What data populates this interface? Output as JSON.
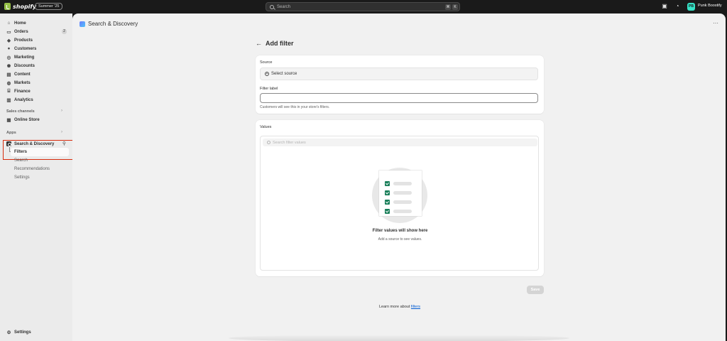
{
  "topbar": {
    "brand": "shopify",
    "edition_badge": "Summer '25",
    "search_placeholder": "Search",
    "shortcut_keys": [
      "⌘",
      "K"
    ],
    "store_initials": "PB",
    "store_name": "Punk Boostify"
  },
  "sidebar": {
    "items": [
      {
        "label": "Home",
        "icon": "home-icon"
      },
      {
        "label": "Orders",
        "icon": "orders-icon",
        "count": "2"
      },
      {
        "label": "Products",
        "icon": "tag-icon"
      },
      {
        "label": "Customers",
        "icon": "person-icon"
      },
      {
        "label": "Marketing",
        "icon": "target-icon"
      },
      {
        "label": "Discounts",
        "icon": "discount-icon"
      },
      {
        "label": "Content",
        "icon": "content-icon"
      },
      {
        "label": "Markets",
        "icon": "globe-icon"
      },
      {
        "label": "Finance",
        "icon": "bank-icon"
      },
      {
        "label": "Analytics",
        "icon": "chart-icon"
      }
    ],
    "sales_channels_label": "Sales channels",
    "online_store_label": "Online Store",
    "apps_label": "Apps",
    "app_name": "Search & Discovery",
    "app_subitems": [
      "Filters",
      "Search",
      "Recommendations",
      "Settings"
    ],
    "settings_label": "Settings"
  },
  "main": {
    "app_title": "Search & Discovery",
    "page_title": "Add filter",
    "source_label": "Source",
    "select_source_label": "Select source",
    "filter_label_label": "Filter label",
    "filter_label_value": "",
    "filter_label_help": "Customers will see this in your store's filters.",
    "values_label": "Values",
    "values_search_placeholder": "Search filter values",
    "empty_title": "Filter values will show here",
    "empty_subtitle": "Add a source to see values.",
    "save_label": "Save",
    "learn_more_prefix": "Learn more about ",
    "learn_more_link": "filters"
  },
  "colors": {
    "accent_green": "#1a7f5a",
    "link_blue": "#005bd3",
    "highlight_red": "#d72c0d",
    "avatar": "#36e3c7"
  }
}
